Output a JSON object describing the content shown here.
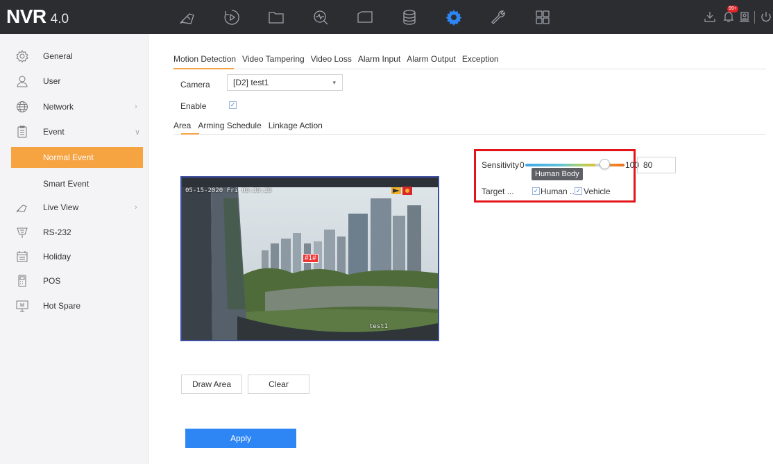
{
  "brand": {
    "name": "NVR",
    "version": "4.0"
  },
  "topbar": {
    "icons": [
      "live-view-icon",
      "playback-icon",
      "file-icon",
      "smart-analysis-icon",
      "intelligent-icon",
      "storage-icon",
      "configuration-icon",
      "maintenance-icon",
      "system-icon"
    ],
    "active": "configuration-icon",
    "alarm_badge": "99+"
  },
  "sidebar": {
    "items": [
      {
        "label": "General",
        "icon": "general-icon"
      },
      {
        "label": "User",
        "icon": "user-icon"
      },
      {
        "label": "Network",
        "icon": "network-icon"
      },
      {
        "label": "Event",
        "icon": "event-icon"
      },
      {
        "label": "Normal Event"
      },
      {
        "label": "Smart Event"
      },
      {
        "label": "Live View",
        "icon": "live-view-icon"
      },
      {
        "label": "RS-232",
        "icon": "rs232-icon"
      },
      {
        "label": "Holiday",
        "icon": "holiday-icon"
      },
      {
        "label": "POS",
        "icon": "pos-icon"
      },
      {
        "label": "Hot Spare",
        "icon": "hot-spare-icon"
      }
    ]
  },
  "tabs": [
    "Motion Detection",
    "Video Tampering",
    "Video Loss",
    "Alarm Input",
    "Alarm Output",
    "Exception"
  ],
  "form": {
    "camera_label": "Camera",
    "camera_value": "[D2] test1",
    "enable_label": "Enable"
  },
  "subtabs": [
    "Area",
    "Arming Schedule",
    "Linkage Action"
  ],
  "video": {
    "timestamp": "05-15-2020 Fri 05:35:25",
    "zone": "#1#",
    "channel_name": "test1"
  },
  "sensitivity": {
    "label": "Sensitivity",
    "min_label": "0",
    "max_label": "100",
    "value": "80",
    "level": 80,
    "tooltip": "Human Body"
  },
  "target": {
    "label": "Target ...",
    "human": "Human ...",
    "vehicle": "Vehicle"
  },
  "buttons": {
    "draw_area": "Draw Area",
    "clear": "Clear",
    "apply": "Apply"
  },
  "colors": {
    "accent": "#f6a342",
    "primary": "#2e86f5",
    "highlight": "#e3141a"
  }
}
